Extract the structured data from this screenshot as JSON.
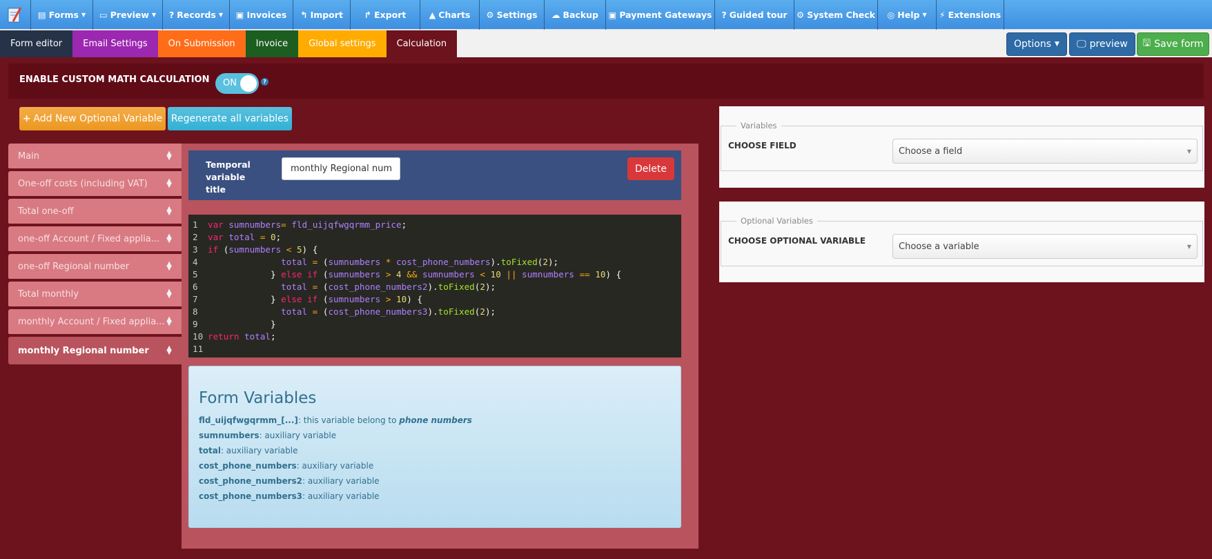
{
  "nav": [
    {
      "label": "Forms",
      "icon": "file-icon",
      "caret": true,
      "w": 90
    },
    {
      "label": "Preview",
      "icon": "monitor-icon",
      "caret": true,
      "w": 101
    },
    {
      "label": "Records",
      "icon": "question-icon",
      "caret": true,
      "w": 97
    },
    {
      "label": "Invoices",
      "icon": "money-icon",
      "caret": false,
      "w": 92
    },
    {
      "label": "Import",
      "icon": "reply-icon",
      "caret": false,
      "w": 83
    },
    {
      "label": "Export",
      "icon": "share-icon",
      "caret": false,
      "w": 101
    },
    {
      "label": "Charts",
      "icon": "chart-icon",
      "caret": false,
      "w": 86
    },
    {
      "label": "Settings",
      "icon": "gear-icon",
      "caret": false,
      "w": 94
    },
    {
      "label": "Backup",
      "icon": "cloud-icon",
      "caret": false,
      "w": 89
    },
    {
      "label": "Payment Gateways",
      "icon": "money-icon",
      "caret": false,
      "w": 158
    },
    {
      "label": "Guided tour",
      "icon": "question-icon",
      "caret": false,
      "w": 115
    },
    {
      "label": "System Check",
      "icon": "gear-icon",
      "caret": false,
      "w": 121
    },
    {
      "label": "Help",
      "icon": "lifebuoy-icon",
      "caret": true,
      "w": 85
    },
    {
      "label": "Extensions",
      "icon": "plug-icon",
      "caret": false,
      "w": 98
    }
  ],
  "tabs": [
    {
      "label": "Form editor",
      "color": "#253248"
    },
    {
      "label": "Email Settings",
      "color": "#9c27b0"
    },
    {
      "label": "On Submission",
      "color": "#ff6d19"
    },
    {
      "label": "Invoice",
      "color": "#1b5e20"
    },
    {
      "label": "Global settings",
      "color": "#ffab00"
    },
    {
      "label": "Calculation",
      "color": "#6d131d"
    }
  ],
  "toolbar": {
    "options": "Options",
    "preview": "preview",
    "save": "Save form"
  },
  "enable": {
    "label": "ENABLE CUSTOM MATH CALCULATION",
    "toggle": "ON",
    "help": "?"
  },
  "buttons": {
    "add": "Add New Optional Variable",
    "regen": "Regenerate all variables"
  },
  "sidebar": [
    "Main",
    "One-off costs (including VAT)",
    "Total one-off",
    "one-off Account / Fixed applia...",
    "one-off Regional number",
    "Total monthly",
    "monthly Account / Fixed applia...",
    "monthly Regional number"
  ],
  "editor": {
    "title_label": "Temporal variable title",
    "title_value": "monthly Regional number",
    "delete": "Delete"
  },
  "code": [
    "var sumnumbers= fld_uijqfwgqrmm_price;",
    "var total = 0;",
    "if (sumnumbers < 5) {",
    "              total = (sumnumbers * cost_phone_numbers).toFixed(2);",
    "            } else if (sumnumbers > 4 && sumnumbers < 10 || sumnumbers == 10) {",
    "              total = (cost_phone_numbers2).toFixed(2);",
    "            } else if (sumnumbers > 10) {",
    "              total = (cost_phone_numbers3).toFixed(2);",
    "            }",
    "return total;",
    ""
  ],
  "form_variables": {
    "title": "Form Variables",
    "items": [
      {
        "name": "fld_uijqfwgqrmm_[...]",
        "desc": ": this variable belong to ",
        "em": "phone numbers"
      },
      {
        "name": "sumnumbers",
        "desc": ": auxiliary variable"
      },
      {
        "name": "total",
        "desc": ": auxiliary variable"
      },
      {
        "name": "cost_phone_numbers",
        "desc": ": auxiliary variable"
      },
      {
        "name": "cost_phone_numbers2",
        "desc": ": auxiliary variable"
      },
      {
        "name": "cost_phone_numbers3",
        "desc": ": auxiliary variable"
      }
    ]
  },
  "variables_panel": {
    "legend": "Variables",
    "label": "CHOOSE FIELD",
    "select": "Choose a field"
  },
  "optional_panel": {
    "legend": "Optional Variables",
    "label": "CHOOSE OPTIONAL VARIABLE",
    "select": "Choose a variable"
  }
}
